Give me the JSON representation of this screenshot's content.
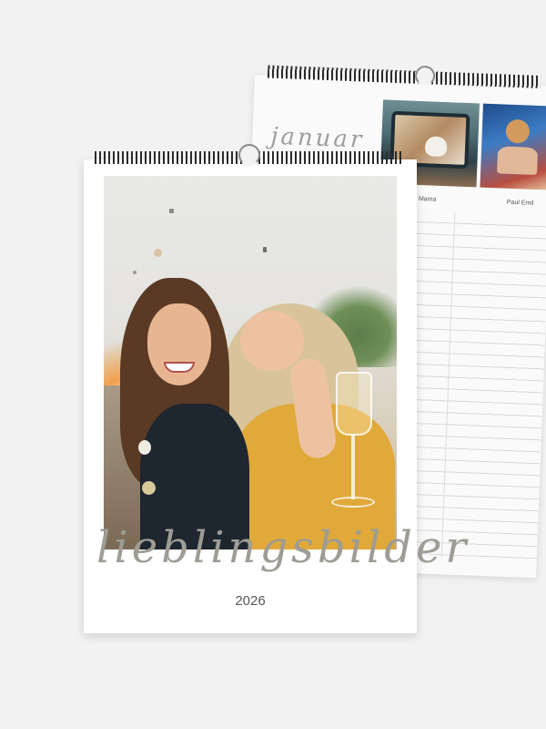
{
  "back_calendar": {
    "month_label": "januar",
    "columns": [
      "Mama",
      "Paul Emil"
    ]
  },
  "front_calendar": {
    "title": "lieblingsbilder",
    "year": "2026"
  }
}
